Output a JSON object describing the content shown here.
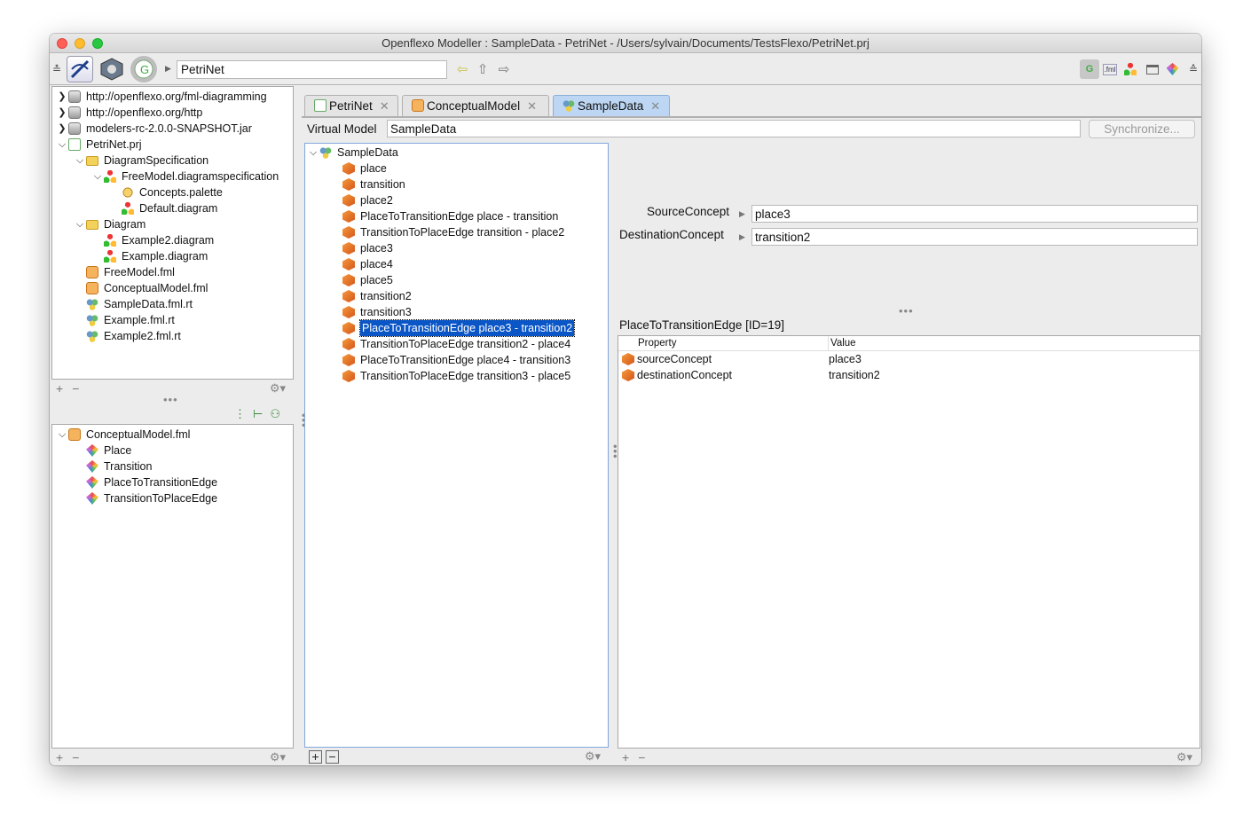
{
  "window": {
    "title": "Openflexo Modeller : SampleData - PetriNet - /Users/sylvain/Documents/TestsFlexo/PetriNet.prj"
  },
  "toolbar": {
    "path_value": "PetriNet"
  },
  "project_tree": {
    "items": [
      {
        "label": "http://openflexo.org/fml-diagramming",
        "icon": "disk-icon"
      },
      {
        "label": "http://openflexo.org/http",
        "icon": "disk-icon"
      },
      {
        "label": "modelers-rc-2.0.0-SNAPSHOT.jar",
        "icon": "disk-icon"
      },
      {
        "label": "PetriNet.prj",
        "icon": "project-icon"
      },
      {
        "label": "DiagramSpecification",
        "icon": "folder-icon"
      },
      {
        "label": "FreeModel.diagramspecification",
        "icon": "diagram-spec-icon"
      },
      {
        "label": "Concepts.palette",
        "icon": "palette-icon"
      },
      {
        "label": "Default.diagram",
        "icon": "diagram-icon"
      },
      {
        "label": "Diagram",
        "icon": "folder-icon"
      },
      {
        "label": "Example2.diagram",
        "icon": "diagram-icon"
      },
      {
        "label": "Example.diagram",
        "icon": "diagram-icon"
      },
      {
        "label": "FreeModel.fml",
        "icon": "fml-icon"
      },
      {
        "label": "ConceptualModel.fml",
        "icon": "fml-icon"
      },
      {
        "label": "SampleData.fml.rt",
        "icon": "runtime-icon"
      },
      {
        "label": "Example.fml.rt",
        "icon": "runtime-icon"
      },
      {
        "label": "Example2.fml.rt",
        "icon": "runtime-icon"
      }
    ]
  },
  "model_tree": {
    "root": "ConceptualModel.fml",
    "items": [
      "Place",
      "Transition",
      "PlaceToTransitionEdge",
      "TransitionToPlaceEdge"
    ]
  },
  "tabs": [
    {
      "label": "PetriNet"
    },
    {
      "label": "ConceptualModel"
    },
    {
      "label": "SampleData"
    }
  ],
  "editor": {
    "virtual_model_label": "Virtual Model",
    "virtual_model_value": "SampleData",
    "synchronize_label": "Synchronize...",
    "instances_root": "SampleData",
    "instances": [
      "place",
      "transition",
      "place2",
      "PlaceToTransitionEdge place - transition",
      "TransitionToPlaceEdge transition - place2",
      "place3",
      "place4",
      "place5",
      "transition2",
      "transition3",
      "PlaceToTransitionEdge place3 - transition2",
      "TransitionToPlaceEdge transition2 - place4",
      "PlaceToTransitionEdge place4 - transition3",
      "TransitionToPlaceEdge transition3 - place5"
    ],
    "selected_index": 10
  },
  "inspector": {
    "source_label": "SourceConcept",
    "source_value": "place3",
    "destination_label": "DestinationConcept",
    "destination_value": "transition2",
    "details_title": "PlaceToTransitionEdge [ID=19]",
    "col_property": "Property",
    "col_value": "Value",
    "rows": [
      {
        "property": "sourceConcept",
        "value": "place3"
      },
      {
        "property": "destinationConcept",
        "value": "transition2"
      }
    ]
  },
  "colors": {
    "selection": "#0a56c7",
    "active_tab": "#bcd6f3"
  }
}
